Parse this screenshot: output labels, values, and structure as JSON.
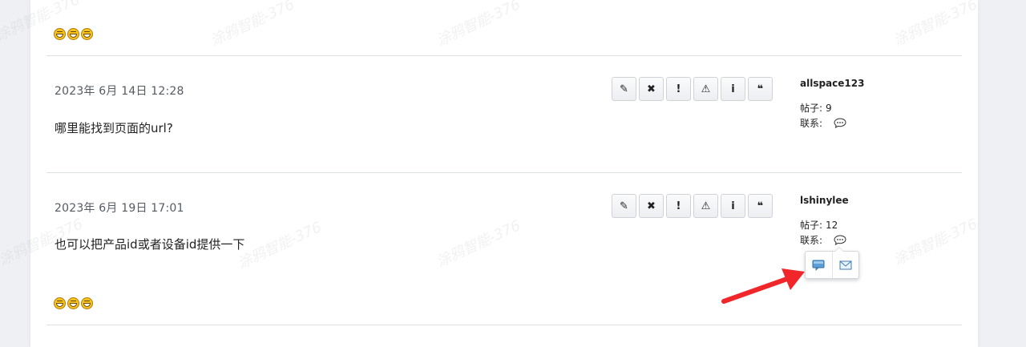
{
  "watermark_text": "涂鸦智能-376",
  "posts": [
    {
      "date": "2023年 6月 14日 12:28",
      "body": "哪里能找到页面的url?",
      "author": "allspace123",
      "posts_label": "帖子:",
      "posts_count": "9",
      "contact_label": "联系:"
    },
    {
      "date": "2023年 6月 19日 17:01",
      "body": "也可以把产品id或者设备id提供一下",
      "author": "lshinylee",
      "posts_label": "帖子:",
      "posts_count": "12",
      "contact_label": "联系:"
    }
  ],
  "toolbar_icons": [
    "pencil-icon",
    "close-icon",
    "exclamation-icon",
    "warning-icon",
    "info-icon",
    "quote-icon"
  ],
  "toolbar_glyphs": {
    "edit": "✎",
    "delete": "✖",
    "report": "!",
    "warn": "⚠",
    "info": "i",
    "quote": "❝"
  },
  "contact_popover": {
    "items": [
      "message-icon",
      "email-icon"
    ]
  },
  "colors": {
    "page_bg": "#eef0f4",
    "panel_bg": "#ffffff",
    "arrow": "#f0262a",
    "emoji": "#f7c21a"
  }
}
